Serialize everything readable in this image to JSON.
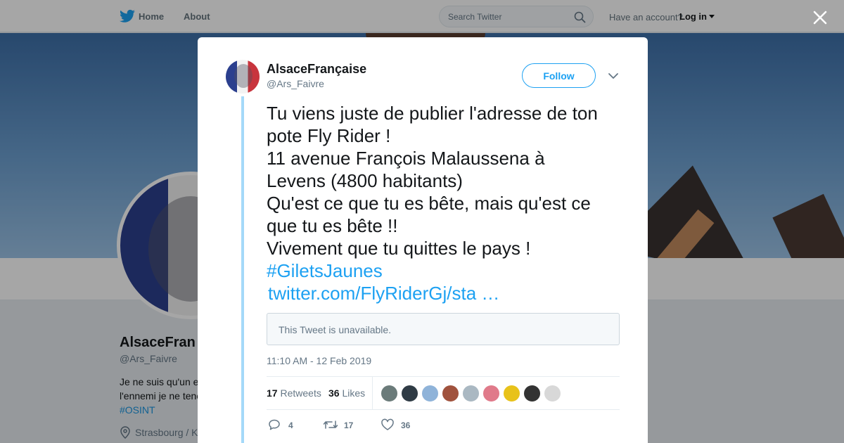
{
  "topnav": {
    "home_label": "Home",
    "about_label": "About",
    "search_placeholder": "Search Twitter",
    "have_account": "Have an account?",
    "login_label": "Log in"
  },
  "profile": {
    "name": "AlsaceFran",
    "handle": "@Ars_Faivre",
    "bio_line1": "Je ne suis qu'un e",
    "bio_line2": "l'ennemi je ne tene",
    "bio_hashtag": "#OSINT",
    "location": "Strasbourg / K"
  },
  "tweet": {
    "author_name": "AlsaceFrançaise",
    "author_handle": "@Ars_Faivre",
    "follow_label": "Follow",
    "text_lines": [
      "Tu viens juste de publier l'adresse de ton",
      "pote Fly Rider !",
      "11 avenue François Malaussena à",
      "Levens (4800 habitants)",
      "Qu'est ce que tu es bête, mais qu'est ce",
      "que tu es bête !!",
      "Vivement que tu quittes le pays !"
    ],
    "hashtag": "#GiletsJaunes",
    "link": "twitter.com/FlyRiderGj/sta …",
    "quoted_unavailable": "This Tweet is unavailable.",
    "timestamp": "11:10 AM - 12 Feb 2019",
    "retweets_count": "17",
    "retweets_label": "Retweets",
    "likes_count": "36",
    "likes_label": "Likes",
    "actions": {
      "reply_count": "4",
      "retweet_count": "17",
      "like_count": "36"
    },
    "liker_avatars": [
      "#6b7b7a",
      "#2f3b45",
      "#8fb3d9",
      "#a0523d",
      "#aab8c2",
      "#e07a8a",
      "#e8c21a",
      "#333333",
      "#d8d8d8"
    ]
  },
  "colors": {
    "accent": "#1da1f2",
    "thread_line": "#a4d9f9",
    "text_secondary": "#657786"
  },
  "icons": [
    "twitter-bird-icon",
    "search-icon",
    "close-icon",
    "chevron-down-icon",
    "location-pin-icon",
    "reply-icon",
    "retweet-icon",
    "heart-icon"
  ]
}
